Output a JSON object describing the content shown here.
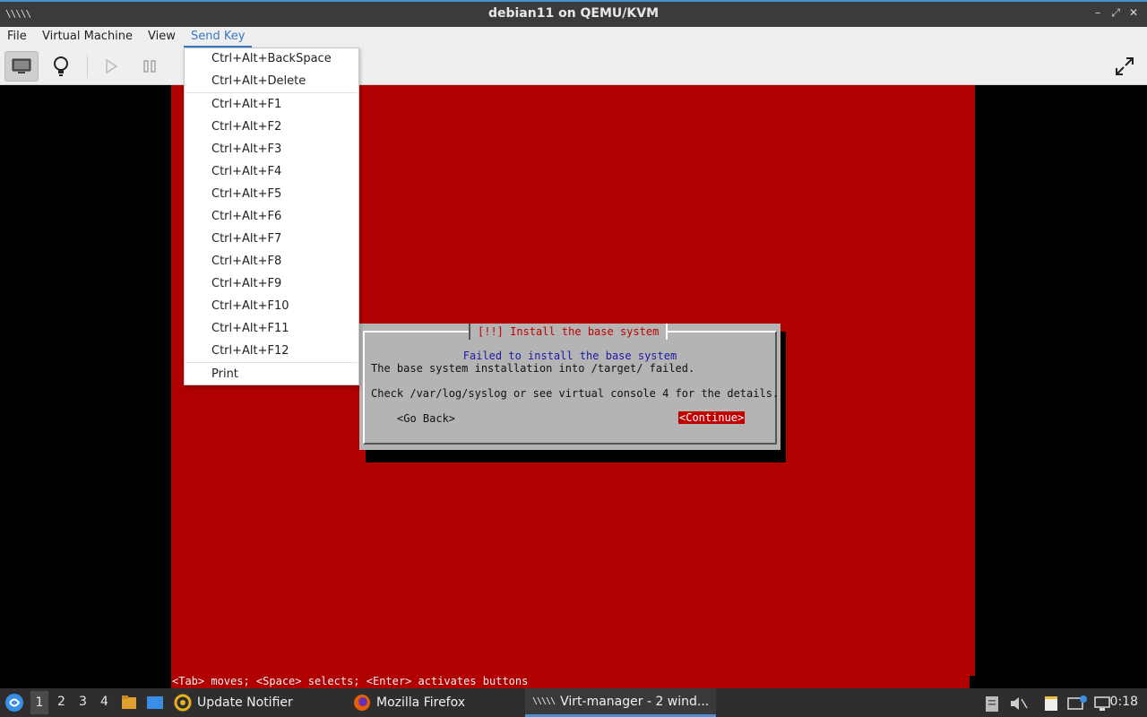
{
  "window": {
    "title": "debian11 on QEMU/KVM",
    "app_icon_glyph": "\\\\\\\\\\",
    "controls": [
      "–",
      "⤢",
      "✕"
    ]
  },
  "menubar": {
    "items": [
      "File",
      "Virtual Machine",
      "View",
      "Send Key"
    ],
    "active": "Send Key"
  },
  "send_key_menu": {
    "items": [
      "Ctrl+Alt+BackSpace",
      "Ctrl+Alt+Delete",
      "Ctrl+Alt+F1",
      "Ctrl+Alt+F2",
      "Ctrl+Alt+F3",
      "Ctrl+Alt+F4",
      "Ctrl+Alt+F5",
      "Ctrl+Alt+F6",
      "Ctrl+Alt+F7",
      "Ctrl+Alt+F8",
      "Ctrl+Alt+F9",
      "Ctrl+Alt+F10",
      "Ctrl+Alt+F11",
      "Ctrl+Alt+F12",
      "Print"
    ]
  },
  "toolbar": {
    "icons": [
      "monitor-icon",
      "lightbulb-icon",
      "play-icon",
      "pause-icon",
      "power-icon",
      "fullscreen-icon"
    ]
  },
  "installer": {
    "dialog_title": "[!!] Install the base system",
    "heading": "Failed to install the base system",
    "line1": "The base system installation into /target/ failed.",
    "line2": "Check /var/log/syslog or see virtual console 4 for the details.",
    "go_back": "<Go Back>",
    "continue": "<Continue>",
    "hint": "<Tab> moves; <Space> selects; <Enter> activates buttons",
    "colors": {
      "background": "#b00000",
      "dialog": "#b4b4b4",
      "heading": "#1a1aa6",
      "title": "#c00000"
    }
  },
  "taskbar": {
    "workspaces": [
      "1",
      "2",
      "3",
      "4"
    ],
    "current_workspace": "1",
    "tasks": [
      "Update Notifier",
      "Mozilla Firefox",
      "Virt-manager - 2 wind..."
    ],
    "clock": "0:18"
  },
  "colors": {
    "accent": "#3a77c4",
    "titlebar": "#3b3b3b",
    "taskbar": "#2e2e2e"
  }
}
